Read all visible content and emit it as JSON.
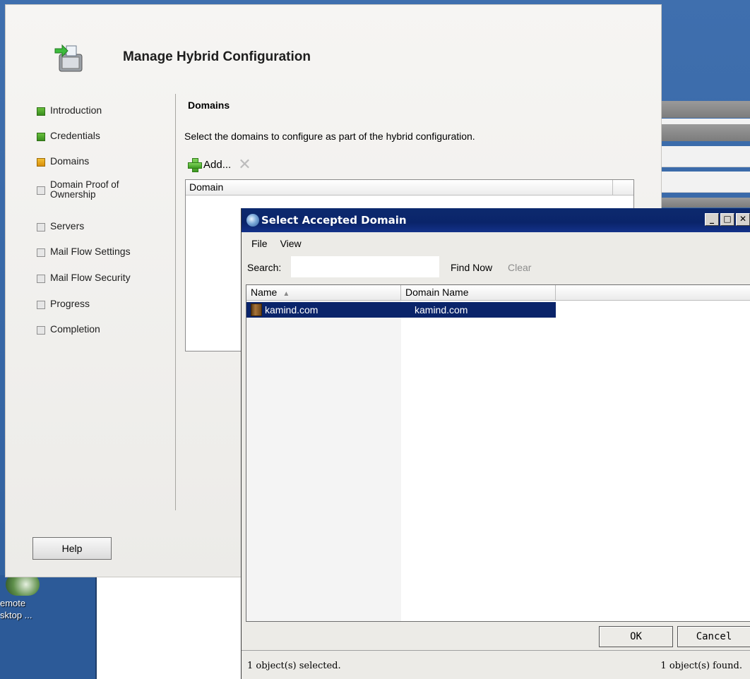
{
  "wizard": {
    "title": "Manage Hybrid Configuration",
    "steps": [
      {
        "label": "Introduction",
        "state": "done"
      },
      {
        "label": "Credentials",
        "state": "done"
      },
      {
        "label": "Domains",
        "state": "current"
      },
      {
        "label": "Domain Proof of\nOwnership",
        "state": "pending"
      },
      {
        "label": "Servers",
        "state": "pending"
      },
      {
        "label": "Mail Flow Settings",
        "state": "pending"
      },
      {
        "label": "Mail Flow Security",
        "state": "pending"
      },
      {
        "label": "Progress",
        "state": "pending"
      },
      {
        "label": "Completion",
        "state": "pending"
      }
    ],
    "section_title": "Domains",
    "instruction": "Select the domains to configure as part of the hybrid configuration.",
    "add_label": "Add...",
    "delete_glyph": "✕",
    "list_header": "Domain",
    "help_label": "Help"
  },
  "dialog": {
    "title": "Select Accepted Domain",
    "menu": [
      "File",
      "View"
    ],
    "search_label": "Search:",
    "search_value": "",
    "find_now": "Find Now",
    "clear": "Clear",
    "columns": [
      "Name",
      "Domain Name"
    ],
    "sort_glyph": "▲",
    "rows": [
      {
        "name": "kamind.com",
        "domain": "kamind.com",
        "selected": true
      }
    ],
    "ok_label": "OK",
    "cancel_label": "Cancel",
    "status_left": "1 object(s) selected.",
    "status_right": "1 object(s) found."
  },
  "desktop": {
    "icon_label": "emote\nsktop ..."
  },
  "colors": {
    "selection": "#0a246a",
    "desktop": "#3f6fae",
    "done": "#4aa52a",
    "current": "#e6a51d"
  }
}
